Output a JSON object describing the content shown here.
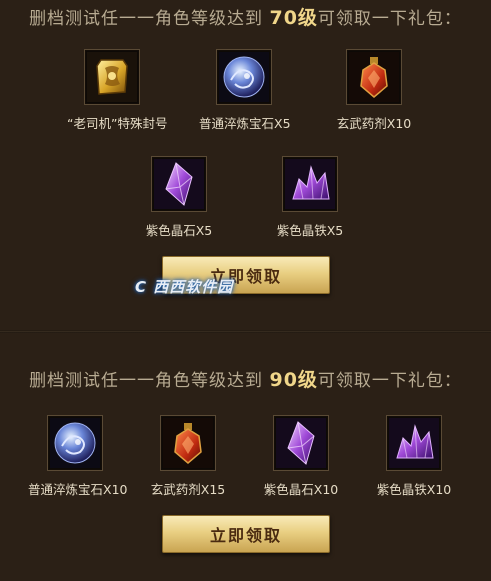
{
  "section1": {
    "title_prefix": "删档测试任一一角色等级达到 ",
    "level": "70级",
    "title_suffix": "可领取一下礼包：",
    "rewards": [
      {
        "name": "“老司机”特殊封号",
        "icon": "title-plaque-icon"
      },
      {
        "name": "普通淬炼宝石X5",
        "icon": "gem-orb-icon"
      },
      {
        "name": "玄武药剂X10",
        "icon": "potion-bottle-icon"
      },
      {
        "name": "紫色晶石X5",
        "icon": "purple-crystal-icon"
      },
      {
        "name": "紫色晶铁X5",
        "icon": "purple-ore-icon"
      }
    ],
    "button_label": "立即领取"
  },
  "section2": {
    "title_prefix": "删档测试任一一角色等级达到 ",
    "level": "90级",
    "title_suffix": "可领取一下礼包：",
    "rewards": [
      {
        "name": "普通淬炼宝石X10",
        "icon": "gem-orb-icon"
      },
      {
        "name": "玄武药剂X15",
        "icon": "potion-bottle-icon"
      },
      {
        "name": "紫色晶石X10",
        "icon": "purple-crystal-icon"
      },
      {
        "name": "紫色晶铁X10",
        "icon": "purple-ore-icon"
      }
    ],
    "button_label": "立即领取"
  },
  "watermark": "C 西西软件园",
  "colors": {
    "background": "#2b2016",
    "level_highlight": "#f0d68a",
    "button_gold": "#e9cf82"
  }
}
